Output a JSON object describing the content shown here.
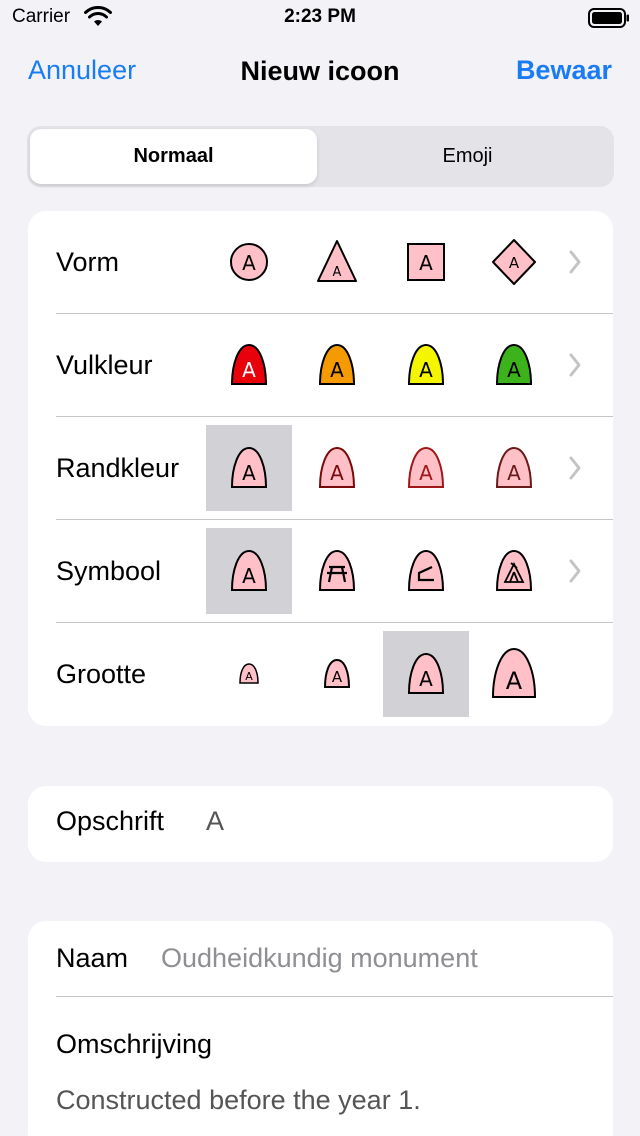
{
  "status_bar": {
    "carrier": "Carrier",
    "time": "2:23 PM"
  },
  "nav": {
    "cancel": "Annuleer",
    "title": "Nieuw icoon",
    "save": "Bewaar"
  },
  "segments": {
    "normal": "Normaal",
    "emoji": "Emoji",
    "selected": "Normaal"
  },
  "style_rows": {
    "shape": {
      "label": "Vorm",
      "options": [
        "circle",
        "triangle",
        "square",
        "diamond"
      ]
    },
    "fill_color": {
      "label": "Vulkleur",
      "options": [
        "#e8000b",
        "#f59a00",
        "#f5f500",
        "#3cb31b"
      ]
    },
    "border_color": {
      "label": "Randkleur",
      "options": [
        "#000000",
        "#7a0a0a",
        "#a01818",
        "#6b1a1a"
      ],
      "selected_index": 0
    },
    "symbol": {
      "label": "Symbool",
      "options": [
        "A",
        "picnic-table",
        "ramp",
        "tent"
      ],
      "selected_index": 0
    },
    "size": {
      "label": "Grootte",
      "options": [
        "extra-small",
        "small",
        "medium",
        "large"
      ],
      "selected_index": 2
    }
  },
  "glyph": "A",
  "colors": {
    "accent": "#1a7cf5",
    "marker_fill": "#ffc0c8"
  },
  "label_field": {
    "title": "Opschrift",
    "value": "A"
  },
  "name_field": {
    "title": "Naam",
    "value": "Oudheidkundig monument"
  },
  "description_field": {
    "title": "Omschrijving",
    "value": "Constructed before the year 1."
  }
}
